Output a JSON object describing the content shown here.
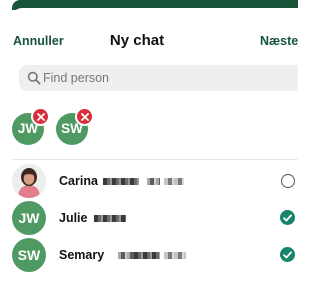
{
  "header": {
    "cancel_label": "Annuller",
    "title": "Ny chat",
    "next_label": "Næste"
  },
  "search": {
    "placeholder": "Find person",
    "value": ""
  },
  "selected": [
    {
      "initials": "JW"
    },
    {
      "initials": "SW"
    }
  ],
  "contacts": [
    {
      "name": "Carina",
      "avatar": "photo",
      "selected": false
    },
    {
      "name": "Julie",
      "initials": "JW",
      "selected": true
    },
    {
      "name": "Semary",
      "initials": "SW",
      "selected": true
    }
  ],
  "colors": {
    "brand": "#17543a",
    "avatar_green": "#4f9a62",
    "remove_red": "#d8303a",
    "check_teal": "#17856a"
  }
}
